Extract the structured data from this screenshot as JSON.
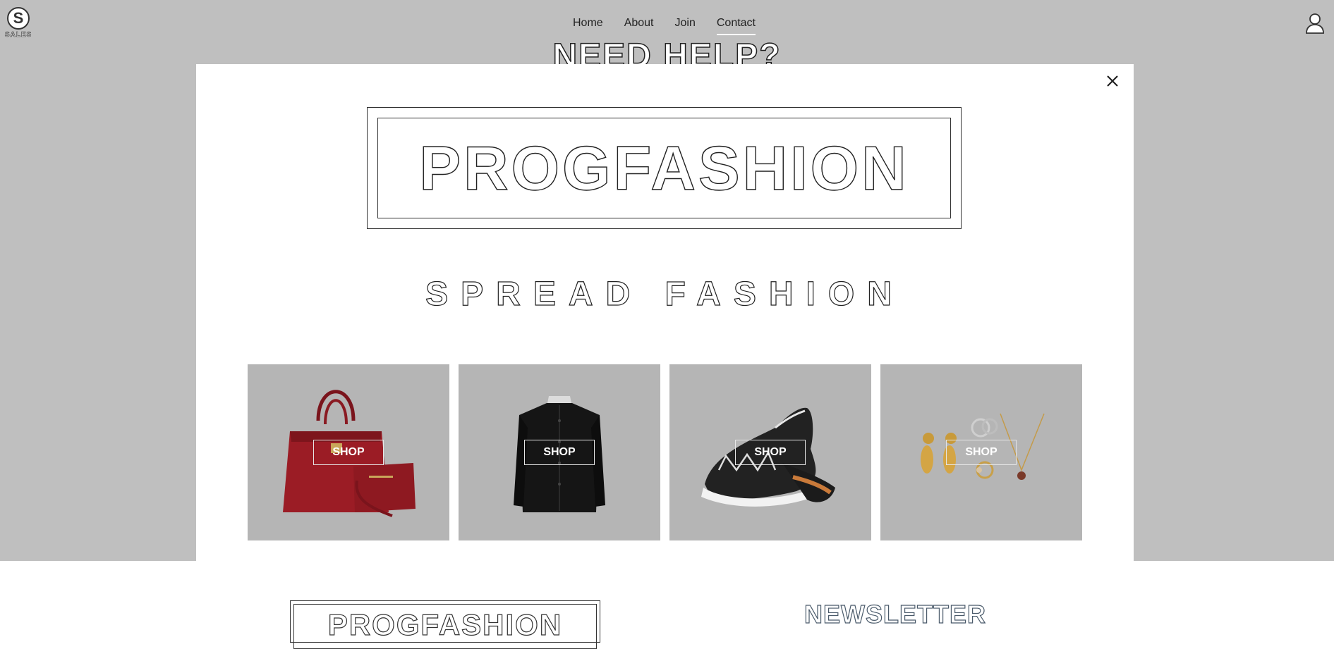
{
  "logo": {
    "letter": "S",
    "text": "SALES"
  },
  "nav": {
    "items": [
      {
        "label": "Home"
      },
      {
        "label": "About"
      },
      {
        "label": "Join"
      },
      {
        "label": "Contact",
        "active": true
      }
    ]
  },
  "header": {
    "background_heading": "NEED HELP?"
  },
  "modal": {
    "brand": "PROGFASHION",
    "tagline": "SPREAD FASHION",
    "products": [
      {
        "image": "red-handbag",
        "button": "SHOP"
      },
      {
        "image": "black-suit-jacket",
        "button": "SHOP"
      },
      {
        "image": "patterned-sneaker",
        "button": "SHOP"
      },
      {
        "image": "gold-jewelry",
        "button": "SHOP"
      }
    ]
  },
  "footer": {
    "brand": "PROGFASHION",
    "newsletter_heading": "NEWSLETTER"
  },
  "colors": {
    "overlay": "#bfbfbf",
    "card_background": "#b5b5b5",
    "modal_background": "#ffffff"
  }
}
